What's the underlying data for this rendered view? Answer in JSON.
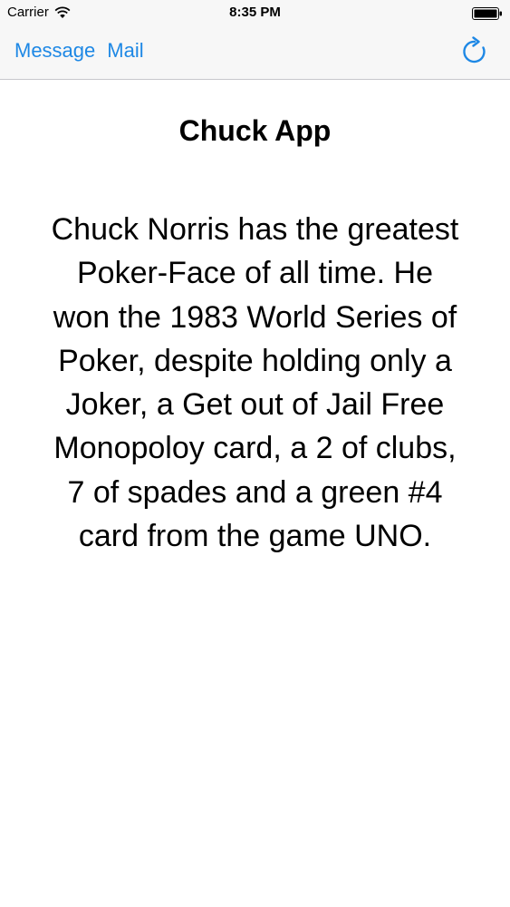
{
  "status_bar": {
    "carrier": "Carrier",
    "time": "8:35 PM",
    "wifi_icon": "wifi-icon",
    "battery_icon": "battery-icon"
  },
  "nav": {
    "message_label": "Message",
    "mail_label": "Mail",
    "refresh_icon": "refresh-icon"
  },
  "content": {
    "title": "Chuck App",
    "joke": "Chuck Norris has the greatest Poker-Face of all time. He won the 1983 World Series of Poker, despite holding only a Joker, a Get out of Jail Free Monopoloy card, a 2 of clubs, 7 of spades and a green #4 card from the game UNO."
  },
  "colors": {
    "accent": "#1e88e5",
    "bar_background": "#f7f7f7"
  }
}
